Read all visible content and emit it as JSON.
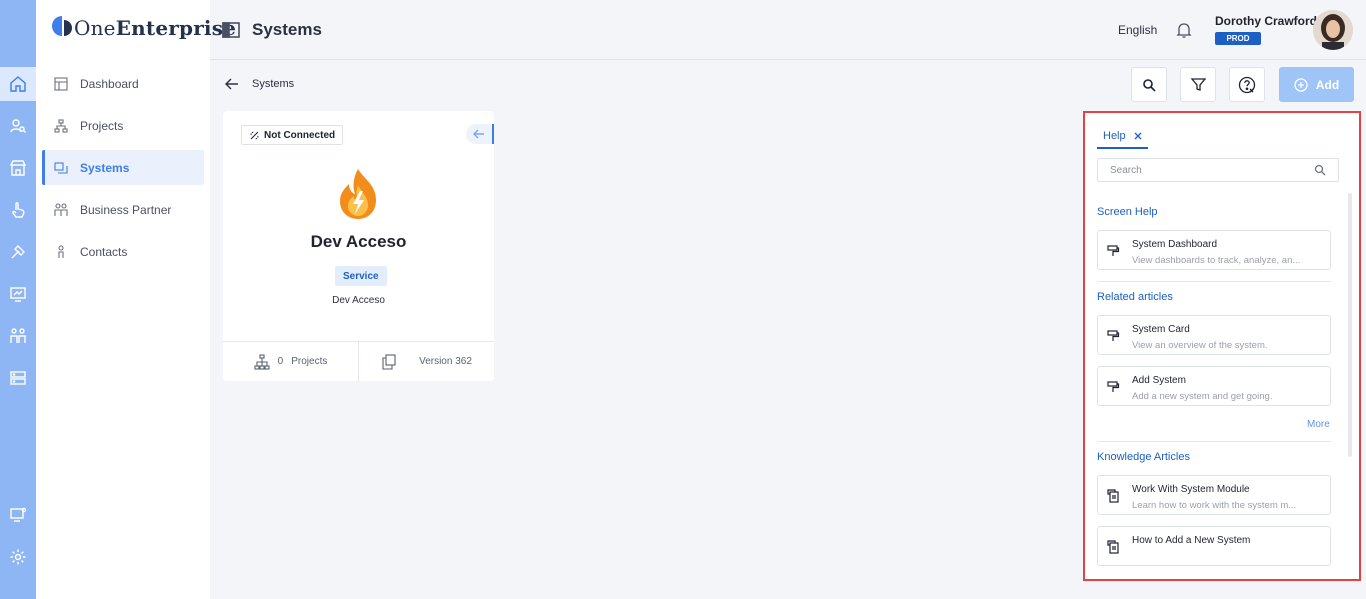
{
  "app": {
    "logo_text_prefix": "One",
    "logo_text_bold": "Enterprise",
    "page_title": "Systems",
    "language": "English",
    "user_name": "Dorothy Crawford",
    "environment_badge": "PROD"
  },
  "rail": {
    "icons": [
      "home-icon",
      "user-search-icon",
      "store-icon",
      "hand-pointer-icon",
      "tools-icon",
      "monitor-chart-icon",
      "people-icon",
      "server-icon",
      "monitor-settings-icon",
      "gear-icon"
    ]
  },
  "sidebar": {
    "items": [
      {
        "label": "Dashboard",
        "icon": "dashboard-icon"
      },
      {
        "label": "Projects",
        "icon": "hierarchy-icon"
      },
      {
        "label": "Systems",
        "icon": "systems-icon"
      },
      {
        "label": "Business Partner",
        "icon": "partners-icon"
      },
      {
        "label": "Contacts",
        "icon": "contact-icon"
      }
    ],
    "active_index": 2
  },
  "breadcrumb": {
    "label": "Systems"
  },
  "toolbar": {
    "add_label": "Add"
  },
  "card": {
    "status": "Not Connected",
    "name": "Dev Acceso",
    "type": "Service",
    "subtitle": "Dev Acceso",
    "projects_count": "0",
    "projects_label": "Projects",
    "version_label": "Version 362"
  },
  "help": {
    "tab_label": "Help",
    "search_placeholder": "Search",
    "screen_help_title": "Screen Help",
    "screen_help": [
      {
        "title": "System Dashboard",
        "desc": "View dashboards to track, analyze, an..."
      }
    ],
    "related_title": "Related articles",
    "related": [
      {
        "title": "System Card",
        "desc": "View an overview of the system."
      },
      {
        "title": "Add System",
        "desc": "Add a new system and get going."
      }
    ],
    "more_label": "More",
    "knowledge_title": "Knowledge Articles",
    "knowledge": [
      {
        "title": "Work With System Module",
        "desc": "Learn how to work with the system m..."
      },
      {
        "title": "How to Add a New System",
        "desc": ""
      }
    ]
  },
  "colors": {
    "rail": "#8fb6f4",
    "accent": "#1d5fc4",
    "add_button": "#9fc4f8",
    "highlight_outline": "#e24444"
  }
}
